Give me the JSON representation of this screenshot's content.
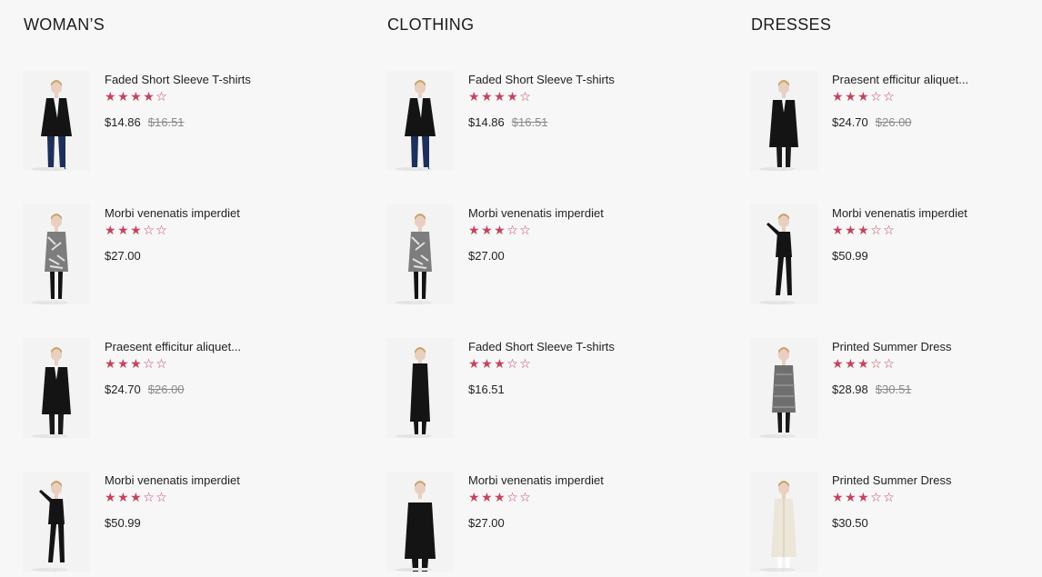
{
  "colors": {
    "background": "#f7f7f8",
    "star": "#c3435c",
    "text": "#222222",
    "old_price": "#8a8a8a"
  },
  "columns": [
    {
      "title": "WOMAN’S",
      "products": [
        {
          "name": "Faded Short Sleeve T-shirts",
          "rating": 4,
          "price": "$14.86",
          "old_price": "$16.51",
          "image": "black-blazer-model"
        },
        {
          "name": "Morbi venenatis imperdiet",
          "rating": 3,
          "price": "$27.00",
          "old_price": "",
          "image": "patterned-coat-model"
        },
        {
          "name": "Praesent efficitur aliquet...",
          "rating": 3,
          "price": "$24.70",
          "old_price": "$26.00",
          "image": "black-peacoat-model"
        },
        {
          "name": "Morbi venenatis imperdiet",
          "rating": 3,
          "price": "$50.99",
          "old_price": "",
          "image": "black-outfit-pose-model"
        }
      ]
    },
    {
      "title": "CLOTHING",
      "products": [
        {
          "name": "Faded Short Sleeve T-shirts",
          "rating": 4,
          "price": "$14.86",
          "old_price": "$16.51",
          "image": "black-blazer-model"
        },
        {
          "name": "Morbi venenatis imperdiet",
          "rating": 3,
          "price": "$27.00",
          "old_price": "",
          "image": "patterned-coat-model"
        },
        {
          "name": "Faded Short Sleeve T-shirts",
          "rating": 3,
          "price": "$16.51",
          "old_price": "",
          "image": "long-black-coat-model"
        },
        {
          "name": "Morbi venenatis imperdiet",
          "rating": 3,
          "price": "$27.00",
          "old_price": "",
          "image": "black-coat-back-model"
        }
      ]
    },
    {
      "title": "DRESSES",
      "products": [
        {
          "name": "Praesent efficitur aliquet...",
          "rating": 3,
          "price": "$24.70",
          "old_price": "$26.00",
          "image": "black-peacoat-model"
        },
        {
          "name": "Morbi venenatis imperdiet",
          "rating": 3,
          "price": "$50.99",
          "old_price": "",
          "image": "black-outfit-pose-model"
        },
        {
          "name": "Printed Summer Dress",
          "rating": 3,
          "price": "$28.98",
          "old_price": "$30.51",
          "image": "grey-tweed-coat-model"
        },
        {
          "name": "Printed Summer Dress",
          "rating": 3,
          "price": "$30.50",
          "old_price": "",
          "image": "cream-trench-model"
        }
      ]
    }
  ]
}
